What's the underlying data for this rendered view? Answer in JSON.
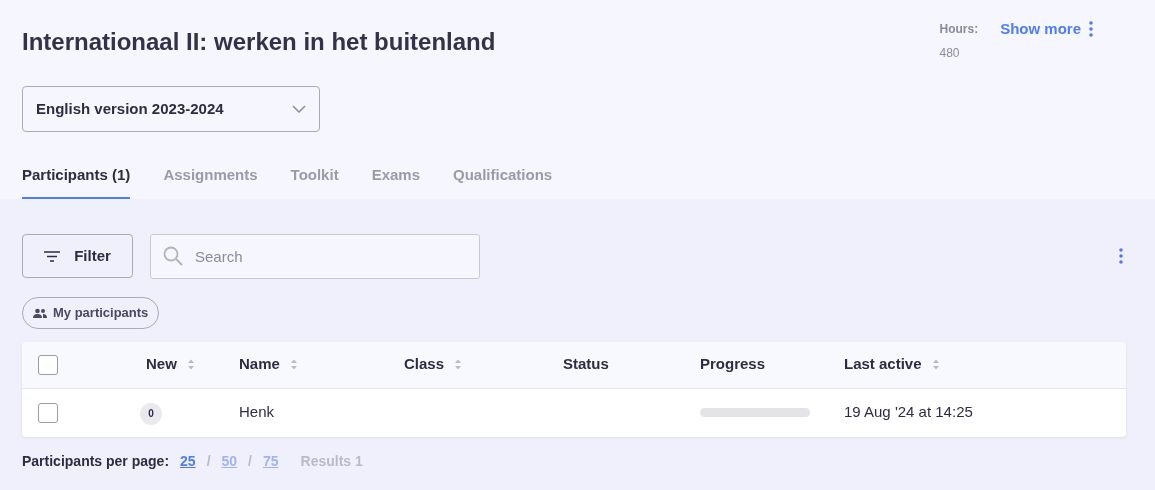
{
  "title": "Internationaal II: werken in het buitenland",
  "hours": {
    "label": "Hours:",
    "value": "480"
  },
  "show_more": "Show more",
  "version_select": {
    "value": "English version 2023-2024"
  },
  "tabs": [
    {
      "label": "Participants (1)",
      "selected": true
    },
    {
      "label": "Assignments",
      "selected": false
    },
    {
      "label": "Toolkit",
      "selected": false
    },
    {
      "label": "Exams",
      "selected": false
    },
    {
      "label": "Qualifications",
      "selected": false
    }
  ],
  "filter_button": "Filter",
  "search": {
    "placeholder": "Search"
  },
  "chip": "My participants",
  "table": {
    "select_all_checked": false,
    "columns": [
      {
        "label": "New",
        "sortable": true
      },
      {
        "label": "Name",
        "sortable": true
      },
      {
        "label": "Class",
        "sortable": true
      },
      {
        "label": "Status",
        "sortable": false
      },
      {
        "label": "Progress",
        "sortable": false
      },
      {
        "label": "Last active",
        "sortable": true
      }
    ],
    "rows": [
      {
        "checked": false,
        "new": "0",
        "name": "Henk",
        "class": "",
        "status": "",
        "level": 0,
        "last_active": "19 Aug '24 at 14:25"
      }
    ]
  },
  "pagination": {
    "label": "Participants per page:",
    "options": [
      {
        "label": "25",
        "selected": true
      },
      {
        "label": "50",
        "selected": false
      },
      {
        "label": "75",
        "selected": false
      }
    ],
    "separator": "/",
    "results": "Results 1"
  }
}
